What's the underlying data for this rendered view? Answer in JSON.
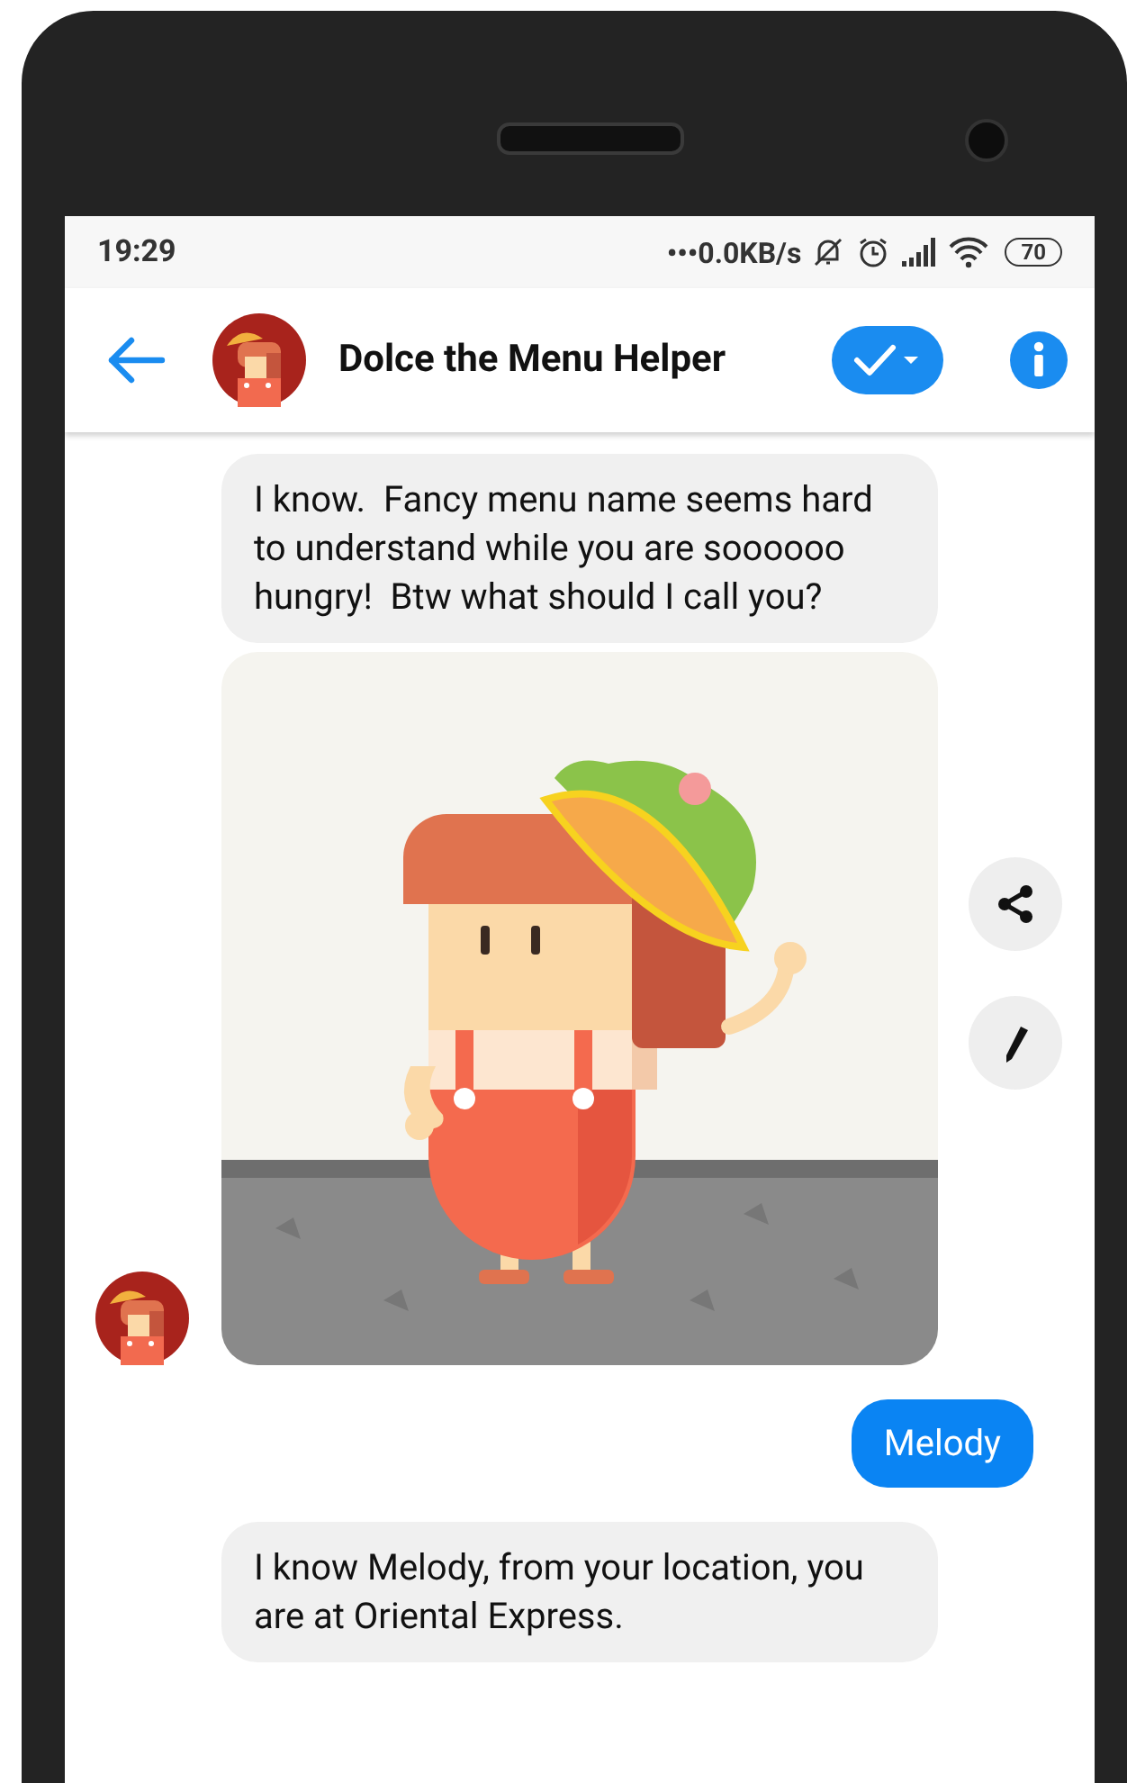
{
  "status_bar": {
    "time": "19:29",
    "net_speed": "•••0.0KB/s",
    "battery": "70"
  },
  "header": {
    "title": "Dolce the Menu Helper"
  },
  "messages": [
    {
      "kind": "incoming",
      "avatar": false,
      "text": "I know.  Fancy menu name seems hard to understand while you are soooooo hungry!  Btw what should I call you?"
    },
    {
      "kind": "image",
      "avatar": true
    },
    {
      "kind": "outgoing",
      "text": "Melody"
    },
    {
      "kind": "incoming",
      "avatar": false,
      "text": "I know Melody, from your location, you are at Oriental Express."
    }
  ]
}
